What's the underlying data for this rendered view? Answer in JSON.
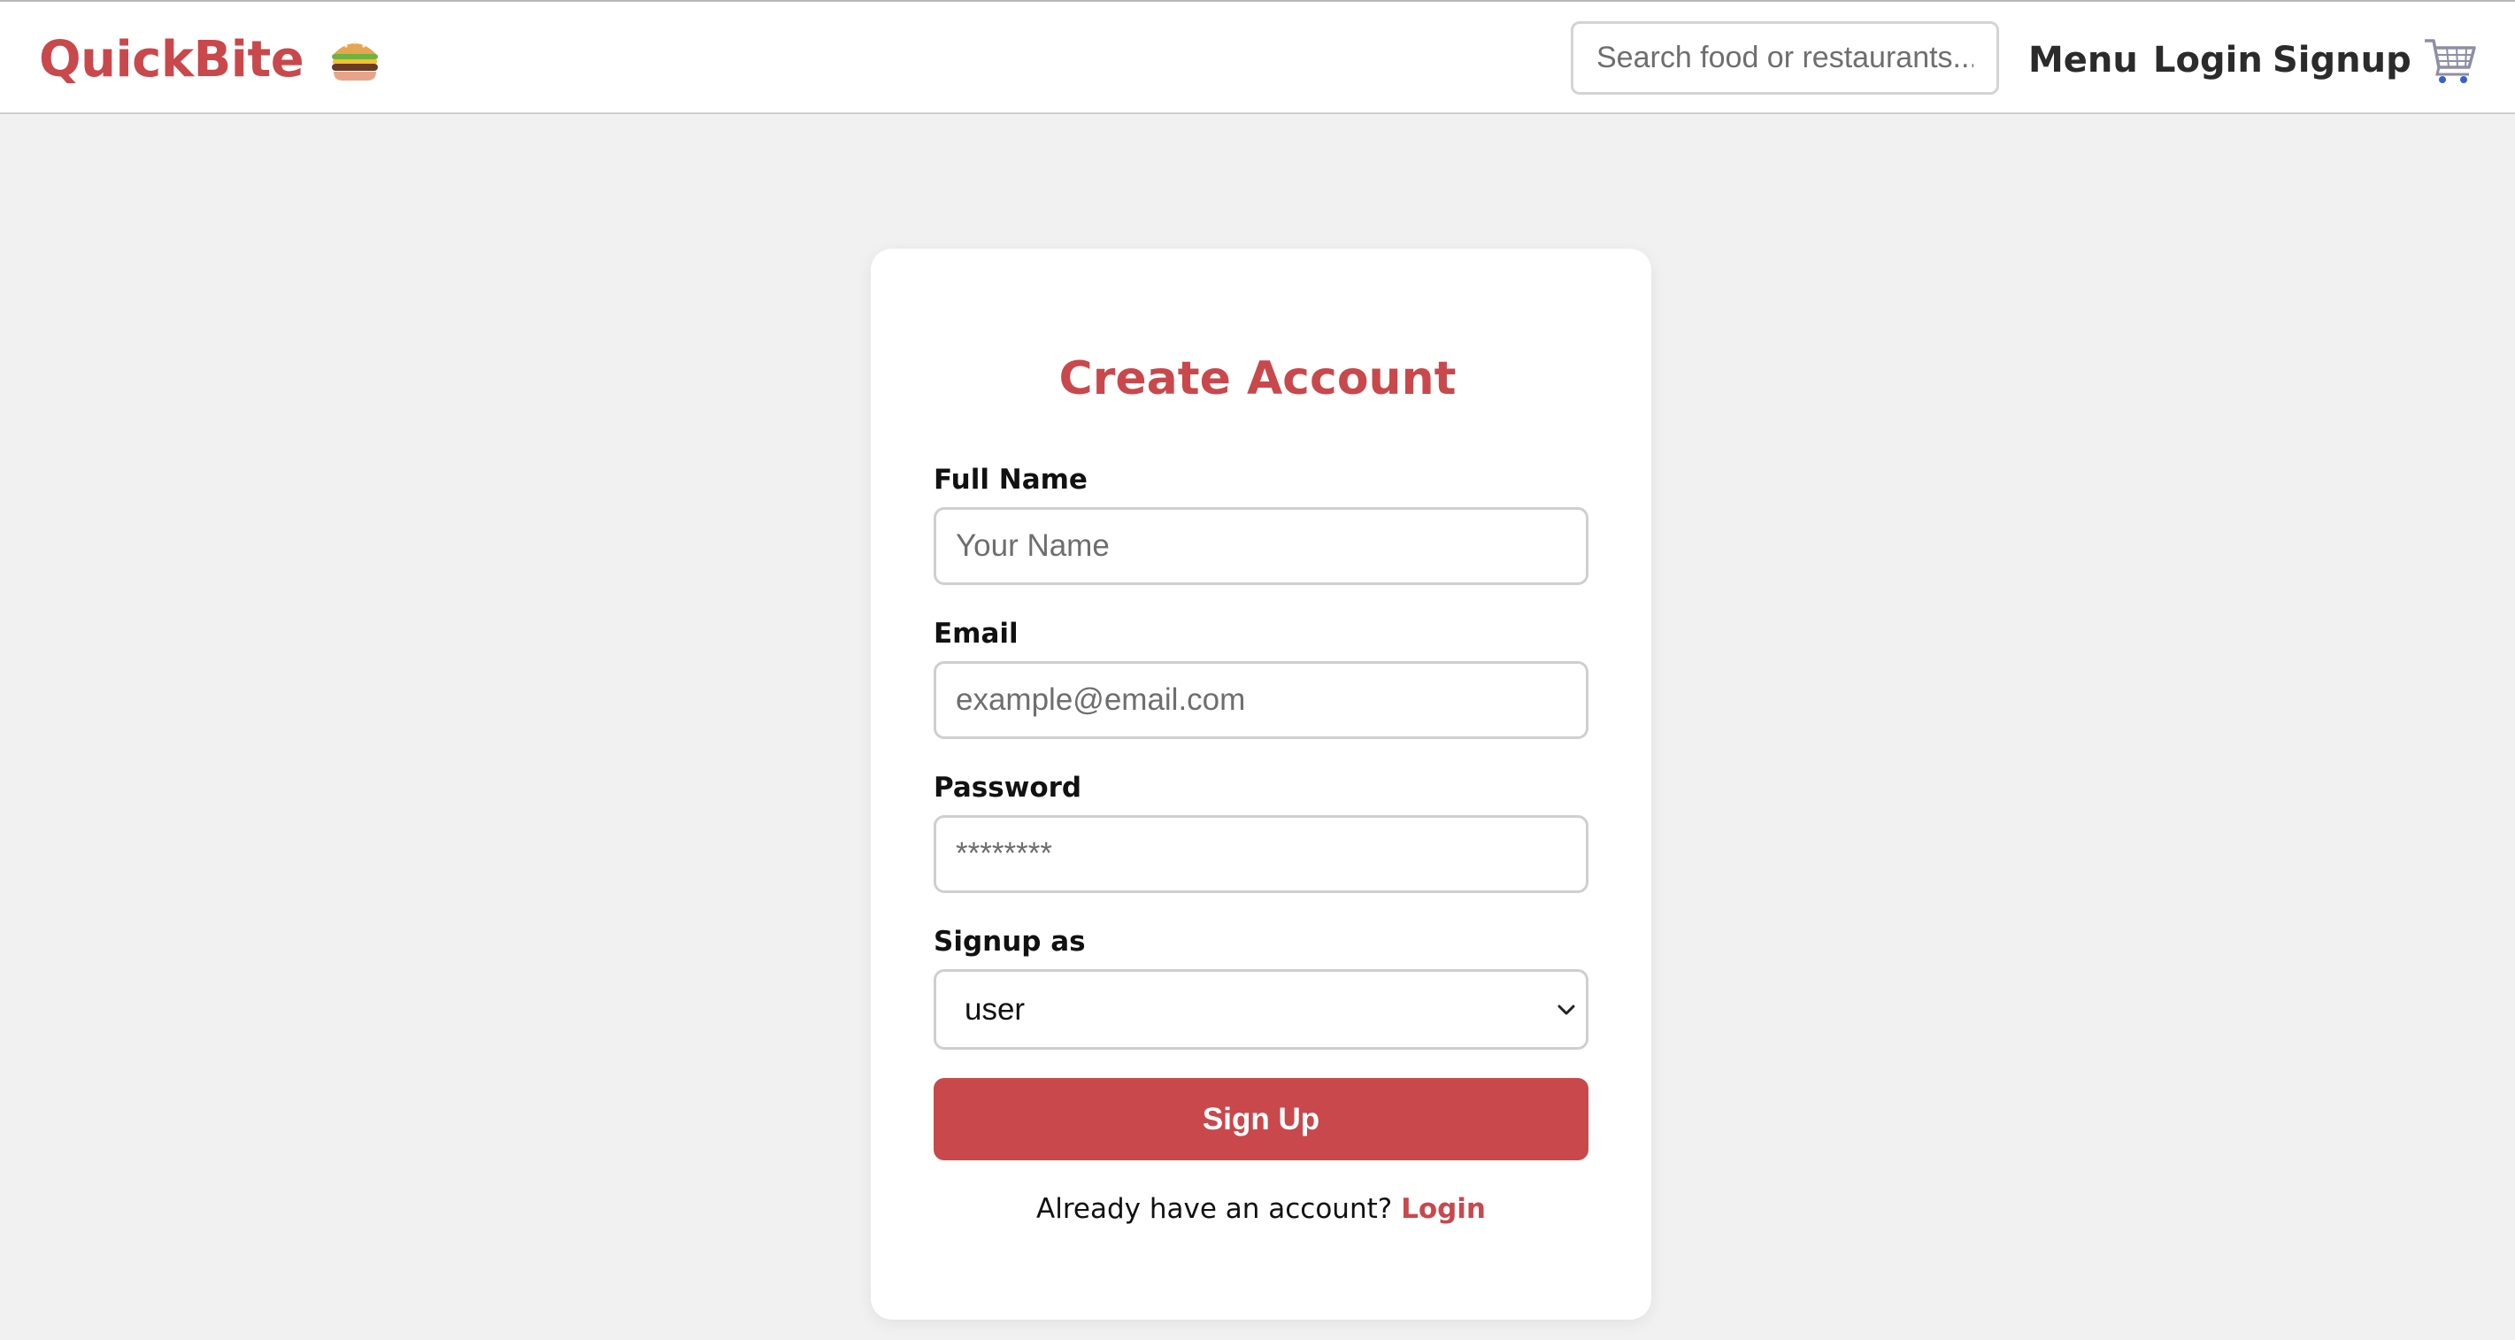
{
  "brand": {
    "name": "QuickBite",
    "icon": "burger-icon"
  },
  "header": {
    "search_placeholder": "Search food or restaurants...",
    "nav": {
      "menu": "Menu",
      "login": "Login",
      "signup": "Signup"
    },
    "cart_icon": "shopping-cart-icon"
  },
  "form": {
    "title": "Create Account",
    "full_name": {
      "label": "Full Name",
      "placeholder": "Your Name"
    },
    "email": {
      "label": "Email",
      "placeholder": "example@email.com"
    },
    "password": {
      "label": "Password",
      "placeholder": "********"
    },
    "role": {
      "label": "Signup as",
      "selected": "user"
    },
    "submit_label": "Sign Up",
    "footer_text": "Already have an account?",
    "footer_link": "Login"
  },
  "colors": {
    "accent": "#c9484c",
    "page_background": "#f1f1f1",
    "card_background": "#ffffff"
  }
}
